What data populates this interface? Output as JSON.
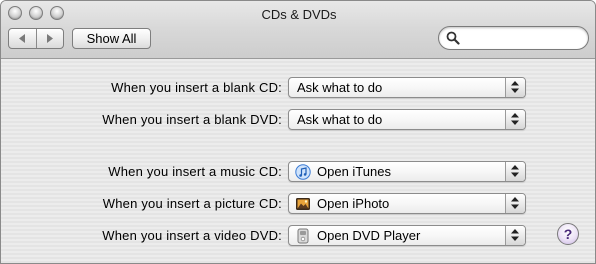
{
  "window": {
    "title": "CDs & DVDs"
  },
  "toolbar": {
    "show_all_label": "Show All",
    "search": {
      "value": "",
      "placeholder": ""
    }
  },
  "rows": [
    {
      "label": "When you insert a blank CD:",
      "value": "Ask what to do",
      "icon": ""
    },
    {
      "label": "When you insert a blank DVD:",
      "value": "Ask what to do",
      "icon": ""
    },
    {
      "label": "When you insert a music CD:",
      "value": "Open iTunes",
      "icon": "itunes-icon"
    },
    {
      "label": "When you insert a picture CD:",
      "value": "Open iPhoto",
      "icon": "iphoto-icon"
    },
    {
      "label": "When you insert a video DVD:",
      "value": "Open DVD Player",
      "icon": "dvd-player-icon"
    }
  ],
  "help": {
    "label": "?"
  },
  "colors": {
    "help_accent": "#4a2a7a",
    "itunes_blue": "#3a7bd5"
  }
}
